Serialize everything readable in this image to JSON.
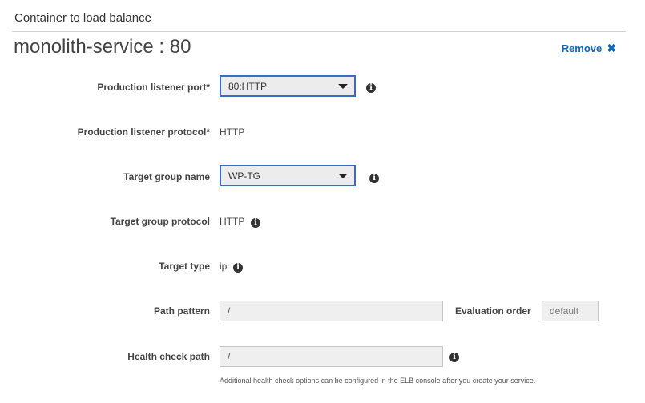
{
  "section": {
    "title": "Container to load balance"
  },
  "service": {
    "heading": "monolith-service : 80",
    "remove_label": "Remove",
    "remove_icon": "close-icon"
  },
  "form": {
    "production_listener_port": {
      "label": "Production listener port*",
      "value": "80:HTTP"
    },
    "production_listener_protocol": {
      "label": "Production listener protocol*",
      "value": "HTTP"
    },
    "target_group_name": {
      "label": "Target group name",
      "value": "WP-TG"
    },
    "target_group_protocol": {
      "label": "Target group protocol",
      "value": "HTTP"
    },
    "target_type": {
      "label": "Target type",
      "value": "ip"
    },
    "path_pattern": {
      "label": "Path pattern",
      "value": "/"
    },
    "evaluation_order": {
      "label": "Evaluation order",
      "placeholder": "default"
    },
    "health_check_path": {
      "label": "Health check path",
      "value": "/",
      "help_text": "Additional health check options can be configured in the ELB console after you create your service."
    }
  },
  "icons": {
    "info": "i"
  },
  "colors": {
    "link": "#1166bb",
    "select_border": "#3b6cc4"
  }
}
